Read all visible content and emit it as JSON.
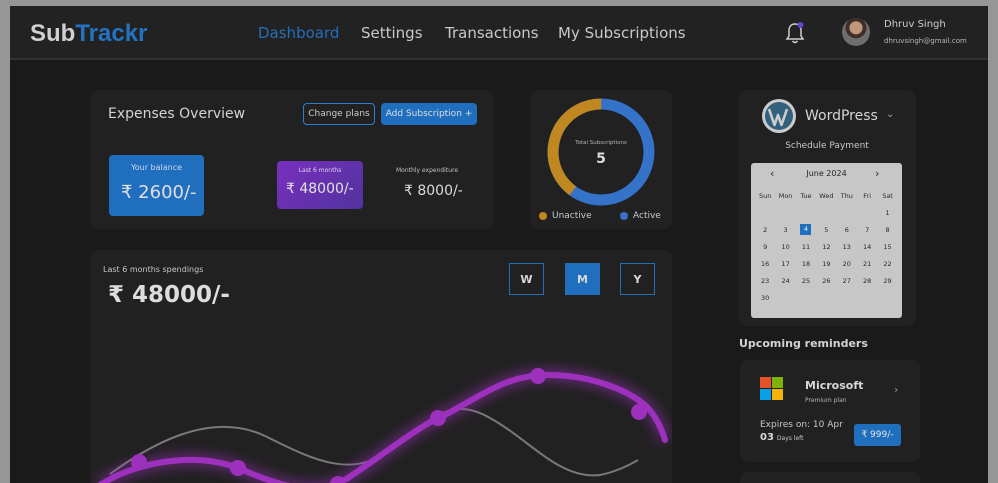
{
  "app": {
    "logo_part1": "Sub",
    "logo_part2": "Trackr"
  },
  "nav": {
    "items": [
      {
        "label": "Dashboard",
        "active": true
      },
      {
        "label": "Settings",
        "active": false
      },
      {
        "label": "Transactions",
        "active": false
      },
      {
        "label": "My Subscriptions",
        "active": false
      }
    ]
  },
  "user": {
    "name": "Dhruv Singh",
    "email": "dhruvsingh@gmail.com"
  },
  "expenses": {
    "title": "Expenses Overview",
    "change_plans_label": "Change plans",
    "add_subscription_label": "Add Subscription +",
    "balance_label": "Your balance",
    "balance_value": "₹ 2600/-",
    "six_months_label": "Last 6 months",
    "six_months_value": "₹ 48000/-",
    "monthly_label": "Monthly expenditure",
    "monthly_value": "₹ 8000/-"
  },
  "subscriptions_donut": {
    "label": "Total Subscriptions",
    "total": "5",
    "inactive_label": "Unactive",
    "active_label": "Active",
    "inactive_fraction": 0.4,
    "colors": {
      "inactive": "#c8891a",
      "active": "#2f74cf"
    }
  },
  "spendings": {
    "label": "Last 6 months spendings",
    "value": "₹ 48000/-",
    "periods": [
      {
        "label": "W",
        "active": false
      },
      {
        "label": "M",
        "active": true
      },
      {
        "label": "Y",
        "active": false
      }
    ]
  },
  "payment": {
    "service_name": "WordPress",
    "schedule_label": "Schedule Payment",
    "calendar": {
      "month_label": "June 2024",
      "weekdays": [
        "Sun",
        "Mon",
        "Tue",
        "Wed",
        "Thu",
        "Fri",
        "Sat"
      ],
      "weeks": [
        [
          "",
          "",
          "",
          "",
          "",
          "",
          "1"
        ],
        [
          "2",
          "3",
          "4",
          "5",
          "6",
          "7",
          "8"
        ],
        [
          "9",
          "10",
          "11",
          "12",
          "13",
          "14",
          "15"
        ],
        [
          "16",
          "17",
          "18",
          "19",
          "20",
          "21",
          "22"
        ],
        [
          "23",
          "24",
          "25",
          "26",
          "27",
          "28",
          "29"
        ],
        [
          "30",
          "",
          "",
          "",
          "",
          "",
          ""
        ]
      ],
      "selected_day": "4"
    }
  },
  "reminders": {
    "title": "Upcoming reminders",
    "items": [
      {
        "name": "Microsoft",
        "plan": "Premium plan",
        "expires": "Expires on: 10 Apr",
        "days": "03",
        "days_suffix": "Days  left",
        "price": "₹ 999/-"
      }
    ]
  },
  "colors": {
    "accent": "#1a6fc6",
    "purple": "#a12bc4",
    "background": "#131313",
    "card": "#1b1b1b"
  }
}
